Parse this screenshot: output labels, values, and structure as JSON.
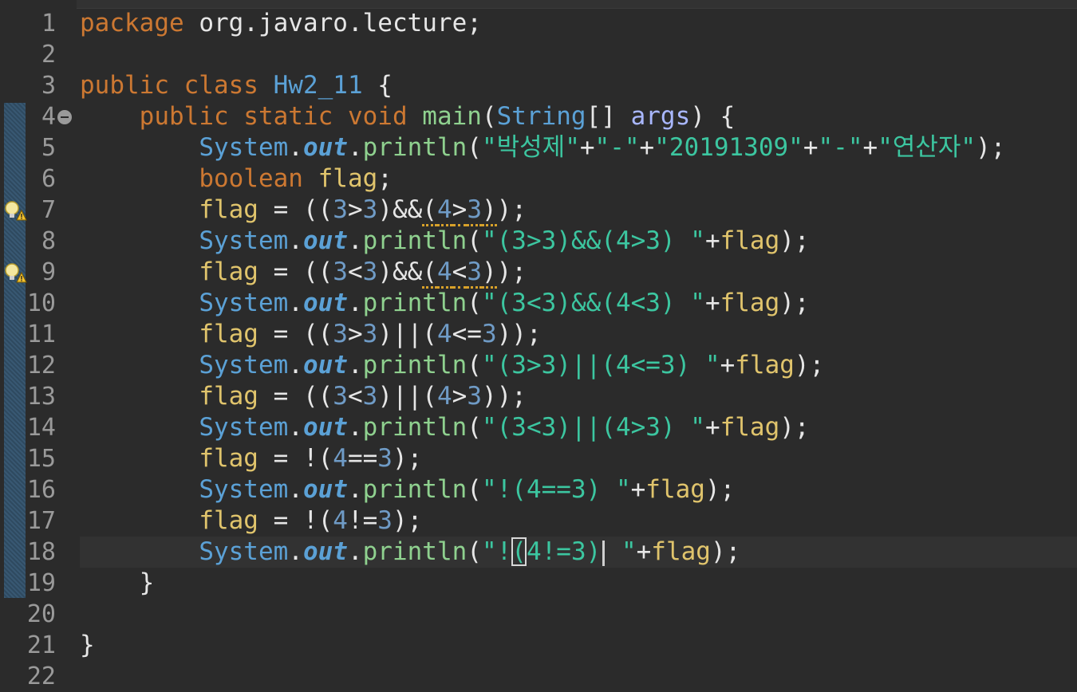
{
  "editor": {
    "lines": [
      {
        "n": "1",
        "tokens": [
          [
            "kw",
            "package"
          ],
          [
            "",
            " org.javaro.lecture;"
          ]
        ]
      },
      {
        "n": "2",
        "tokens": []
      },
      {
        "n": "3",
        "tokens": [
          [
            "kw",
            "public class "
          ],
          [
            "cls",
            "Hw2_11"
          ],
          [
            "",
            " {"
          ]
        ]
      },
      {
        "n": "4",
        "tokens": [
          [
            "",
            " "
          ],
          [
            "kw",
            "   public static void "
          ],
          [
            "fn",
            "main"
          ],
          [
            "",
            "("
          ],
          [
            "cls",
            "String"
          ],
          [
            "",
            "[] "
          ],
          [
            "par",
            "args"
          ],
          [
            "",
            ") {"
          ]
        ]
      },
      {
        "n": "5",
        "tokens": [
          [
            "",
            "        "
          ],
          [
            "cls",
            "System"
          ],
          [
            "",
            "."
          ],
          [
            "fld",
            "out"
          ],
          [
            "",
            "."
          ],
          [
            "fn",
            "println"
          ],
          [
            "",
            "("
          ],
          [
            "str",
            "\"박성제\""
          ],
          [
            "",
            "+"
          ],
          [
            "str",
            "\"-\""
          ],
          [
            "",
            "+"
          ],
          [
            "str",
            "\"20191309\""
          ],
          [
            "",
            "+"
          ],
          [
            "str",
            "\"-\""
          ],
          [
            "",
            "+"
          ],
          [
            "str",
            "\"연산자\""
          ],
          [
            "",
            ");"
          ]
        ]
      },
      {
        "n": "6",
        "tokens": [
          [
            "",
            "        "
          ],
          [
            "kw",
            "boolean "
          ],
          [
            "var",
            "flag"
          ],
          [
            "",
            ";"
          ]
        ]
      },
      {
        "n": "7",
        "tokens": [
          [
            "",
            "        "
          ],
          [
            "var",
            "flag"
          ],
          [
            "",
            " = (("
          ],
          [
            "num",
            "3"
          ],
          [
            "",
            ">"
          ],
          [
            "num",
            "3"
          ],
          [
            "",
            ")&&"
          ],
          [
            "warn",
            "("
          ],
          [
            "warnnum",
            "4"
          ],
          [
            "warn",
            ">"
          ],
          [
            "warnnum",
            "3"
          ],
          [
            "warn",
            ")"
          ],
          [
            "",
            ");"
          ]
        ]
      },
      {
        "n": "8",
        "tokens": [
          [
            "",
            "        "
          ],
          [
            "cls",
            "System"
          ],
          [
            "",
            "."
          ],
          [
            "fld",
            "out"
          ],
          [
            "",
            "."
          ],
          [
            "fn",
            "println"
          ],
          [
            "",
            "("
          ],
          [
            "str",
            "\"(3>3)&&(4>3) \""
          ],
          [
            "",
            "+"
          ],
          [
            "var",
            "flag"
          ],
          [
            "",
            ");"
          ]
        ]
      },
      {
        "n": "9",
        "tokens": [
          [
            "",
            "        "
          ],
          [
            "var",
            "flag"
          ],
          [
            "",
            " = (("
          ],
          [
            "num",
            "3"
          ],
          [
            "",
            "<"
          ],
          [
            "num",
            "3"
          ],
          [
            "",
            ")&&"
          ],
          [
            "warn",
            "("
          ],
          [
            "warnnum",
            "4"
          ],
          [
            "warn",
            "<"
          ],
          [
            "warnnum",
            "3"
          ],
          [
            "warn",
            ")"
          ],
          [
            "",
            ");"
          ]
        ]
      },
      {
        "n": "10",
        "tokens": [
          [
            "",
            "        "
          ],
          [
            "cls",
            "System"
          ],
          [
            "",
            "."
          ],
          [
            "fld",
            "out"
          ],
          [
            "",
            "."
          ],
          [
            "fn",
            "println"
          ],
          [
            "",
            "("
          ],
          [
            "str",
            "\"(3<3)&&(4<3) \""
          ],
          [
            "",
            "+"
          ],
          [
            "var",
            "flag"
          ],
          [
            "",
            ");"
          ]
        ]
      },
      {
        "n": "11",
        "tokens": [
          [
            "",
            "        "
          ],
          [
            "var",
            "flag"
          ],
          [
            "",
            " = (("
          ],
          [
            "num",
            "3"
          ],
          [
            "",
            ">"
          ],
          [
            "num",
            "3"
          ],
          [
            "",
            ")||("
          ],
          [
            "num",
            "4"
          ],
          [
            "",
            "<="
          ],
          [
            "num",
            "3"
          ],
          [
            "",
            "));"
          ]
        ]
      },
      {
        "n": "12",
        "tokens": [
          [
            "",
            "        "
          ],
          [
            "cls",
            "System"
          ],
          [
            "",
            "."
          ],
          [
            "fld",
            "out"
          ],
          [
            "",
            "."
          ],
          [
            "fn",
            "println"
          ],
          [
            "",
            "("
          ],
          [
            "str",
            "\"(3>3)||(4<=3) \""
          ],
          [
            "",
            "+"
          ],
          [
            "var",
            "flag"
          ],
          [
            "",
            ");"
          ]
        ]
      },
      {
        "n": "13",
        "tokens": [
          [
            "",
            "        "
          ],
          [
            "var",
            "flag"
          ],
          [
            "",
            " = (("
          ],
          [
            "num",
            "3"
          ],
          [
            "",
            "<"
          ],
          [
            "num",
            "3"
          ],
          [
            "",
            ")||("
          ],
          [
            "num",
            "4"
          ],
          [
            "",
            ">"
          ],
          [
            "num",
            "3"
          ],
          [
            "",
            "));"
          ]
        ]
      },
      {
        "n": "14",
        "tokens": [
          [
            "",
            "        "
          ],
          [
            "cls",
            "System"
          ],
          [
            "",
            "."
          ],
          [
            "fld",
            "out"
          ],
          [
            "",
            "."
          ],
          [
            "fn",
            "println"
          ],
          [
            "",
            "("
          ],
          [
            "str",
            "\"(3<3)||(4>3) \""
          ],
          [
            "",
            "+"
          ],
          [
            "var",
            "flag"
          ],
          [
            "",
            ");"
          ]
        ]
      },
      {
        "n": "15",
        "tokens": [
          [
            "",
            "        "
          ],
          [
            "var",
            "flag"
          ],
          [
            "",
            " = !("
          ],
          [
            "num",
            "4"
          ],
          [
            "",
            "=="
          ],
          [
            "num",
            "3"
          ],
          [
            "",
            ");"
          ]
        ]
      },
      {
        "n": "16",
        "tokens": [
          [
            "",
            "        "
          ],
          [
            "cls",
            "System"
          ],
          [
            "",
            "."
          ],
          [
            "fld",
            "out"
          ],
          [
            "",
            "."
          ],
          [
            "fn",
            "println"
          ],
          [
            "",
            "("
          ],
          [
            "str",
            "\"!(4==3) \""
          ],
          [
            "",
            "+"
          ],
          [
            "var",
            "flag"
          ],
          [
            "",
            ");"
          ]
        ]
      },
      {
        "n": "17",
        "tokens": [
          [
            "",
            "        "
          ],
          [
            "var",
            "flag"
          ],
          [
            "",
            " = !("
          ],
          [
            "num",
            "4"
          ],
          [
            "",
            "!="
          ],
          [
            "num",
            "3"
          ],
          [
            "",
            ");"
          ]
        ]
      },
      {
        "n": "18",
        "tokens": [
          [
            "",
            "        "
          ],
          [
            "cls",
            "System"
          ],
          [
            "",
            "."
          ],
          [
            "fld",
            "out"
          ],
          [
            "",
            "."
          ],
          [
            "fn",
            "println"
          ],
          [
            "",
            "("
          ],
          [
            "str",
            "\"!"
          ],
          [
            "box",
            "("
          ],
          [
            "str",
            "4!=3)"
          ],
          [
            "caret",
            ""
          ],
          [
            "str",
            " \""
          ],
          [
            "",
            "+"
          ],
          [
            "var",
            "flag"
          ],
          [
            "",
            ");"
          ]
        ]
      },
      {
        "n": "19",
        "tokens": [
          [
            "",
            "    }"
          ]
        ]
      },
      {
        "n": "20",
        "tokens": []
      },
      {
        "n": "21",
        "tokens": [
          [
            "",
            "}"
          ]
        ]
      },
      {
        "n": "22",
        "tokens": []
      }
    ],
    "current_line": "18",
    "warning_lines": [
      "7",
      "9"
    ],
    "fold_line": "4",
    "colors": {
      "background": "#2b2b2b",
      "keyword": "#cc7832",
      "class": "#5ba1d6",
      "method": "#8fd18f",
      "string": "#3cc6a0",
      "number": "#6f9bc6",
      "variable": "#e0c46c",
      "warning_underline": "#d8a12a"
    }
  }
}
